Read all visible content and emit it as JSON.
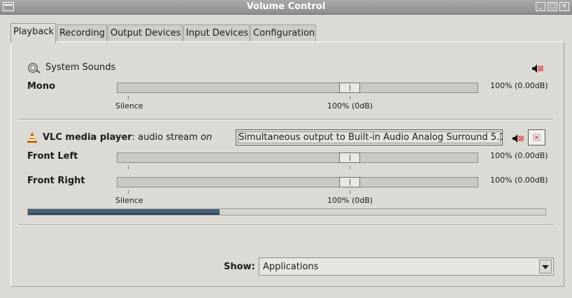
{
  "window": {
    "title": "Volume Control"
  },
  "tabs": [
    {
      "label": "Playback",
      "active": true
    },
    {
      "label": "Recording",
      "active": false
    },
    {
      "label": "Output Devices",
      "active": false
    },
    {
      "label": "Input Devices",
      "active": false
    },
    {
      "label": "Configuration",
      "active": false
    }
  ],
  "system_sounds": {
    "name": "System Sounds",
    "channels": [
      {
        "label": "Mono",
        "value_text": "100% (0.00dB)",
        "level_percent": 100
      }
    ],
    "scale_left": "Silence",
    "scale_center": "100% (0dB)"
  },
  "vlc": {
    "name": "VLC media player",
    "stream_text": ": audio stream ",
    "stream_state": "on",
    "device_button": "Simultaneous output to Built-in Audio Analog Surround 5.1",
    "channels": [
      {
        "label": "Front Left",
        "value_text": "100% (0.00dB)",
        "level_percent": 100
      },
      {
        "label": "Front Right",
        "value_text": "100% (0.00dB)",
        "level_percent": 100
      }
    ],
    "scale_left": "Silence",
    "scale_center": "100% (0dB)",
    "peak_meter_percent": 37
  },
  "show": {
    "label": "Show:",
    "value": "Applications"
  },
  "colors": {
    "meter": "#4a5f78",
    "titlebar": "#9a9a9a",
    "mute_red": "#d01818"
  }
}
